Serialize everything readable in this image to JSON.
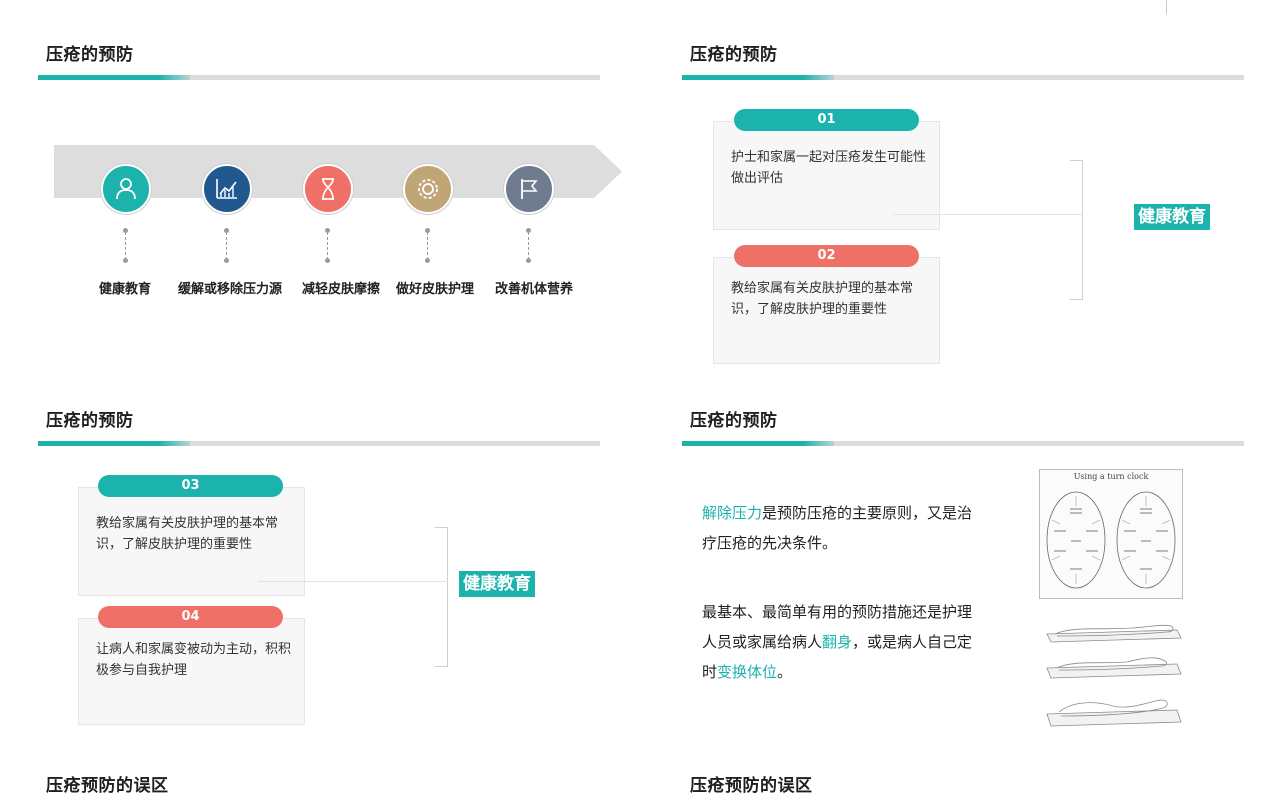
{
  "slide1": {
    "title": "压疮的预防",
    "steps": [
      {
        "label": "健康教育",
        "icon": "person-icon",
        "color": "#1db3ad"
      },
      {
        "label": "缓解或移除压力源",
        "icon": "chart-icon",
        "color": "#21588f"
      },
      {
        "label": "减轻皮肤摩擦",
        "icon": "hourglass-icon",
        "color": "#ef7066"
      },
      {
        "label": "做好皮肤护理",
        "icon": "gear-icon",
        "color": "#c0a677"
      },
      {
        "label": "改善机体营养",
        "icon": "flag-icon",
        "color": "#6f7b8f"
      }
    ]
  },
  "slide2": {
    "title": "压疮的预防",
    "cards": [
      {
        "num": "01",
        "text": "护士和家属一起对压疮发生可能性做出评估"
      },
      {
        "num": "02",
        "text": "教给家属有关皮肤护理的基本常识，了解皮肤护理的重要性"
      }
    ],
    "tag": "健康教育"
  },
  "slide3": {
    "title": "压疮的预防",
    "cards": [
      {
        "num": "03",
        "text": "教给家属有关皮肤护理的基本常识，了解皮肤护理的重要性"
      },
      {
        "num": "04",
        "text": "让病人和家属变被动为主动，积积极参与自我护理"
      }
    ],
    "tag": "健康教育"
  },
  "slide4": {
    "title": "压疮的预防",
    "para1": {
      "hl": "解除压力",
      "rest": "是预防压疮的主要原则，又是治疗压疮的先决条件。"
    },
    "para2": {
      "a": "最基本、最简单有用的预防措施还是护理人员或家属给病人",
      "hl1": "翻身",
      "b": "，或是病人自己定时",
      "hl2": "变换体位",
      "c": "。"
    },
    "figure_title": "Using a turn clock"
  },
  "slide5": {
    "title": "压疮预防的误区"
  },
  "slide6": {
    "title": "压疮预防的误区"
  },
  "colors": {
    "accent": "#1db3ad",
    "coral": "#ef7066",
    "navy": "#21588f"
  }
}
